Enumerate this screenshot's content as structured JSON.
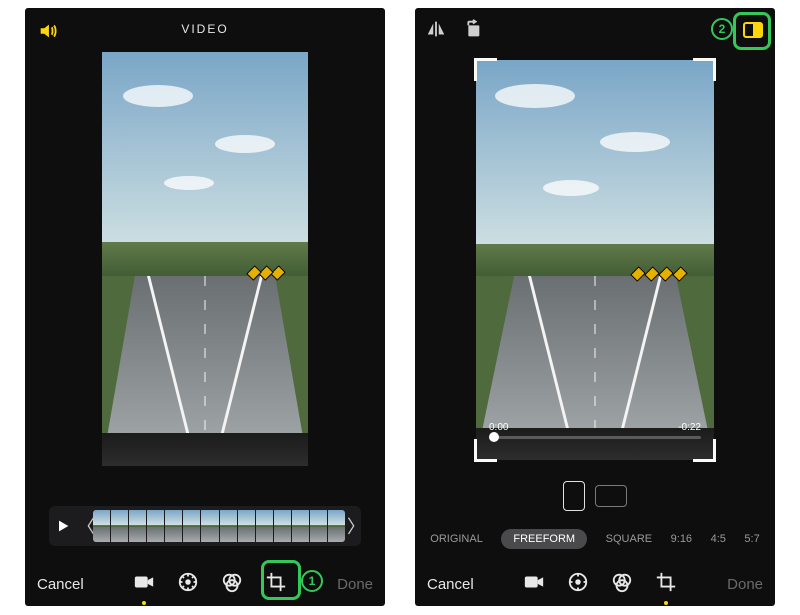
{
  "left": {
    "title": "VIDEO",
    "cancel": "Cancel",
    "done": "Done",
    "annotation": "1",
    "tools": [
      "video-icon",
      "adjust-icon",
      "filters-icon",
      "crop-icon"
    ]
  },
  "right": {
    "time_start": "0:00",
    "time_end": "-0:22",
    "cancel": "Cancel",
    "done": "Done",
    "annotation": "2",
    "ratios": {
      "original": "ORIGINAL",
      "freeform": "FREEFORM",
      "square": "SQUARE",
      "r916": "9:16",
      "r45": "4:5",
      "r57": "5:7"
    },
    "orientation": {
      "portrait_selected": true
    }
  },
  "colors": {
    "accent": "#34c759",
    "yellow": "#ffd60a"
  }
}
